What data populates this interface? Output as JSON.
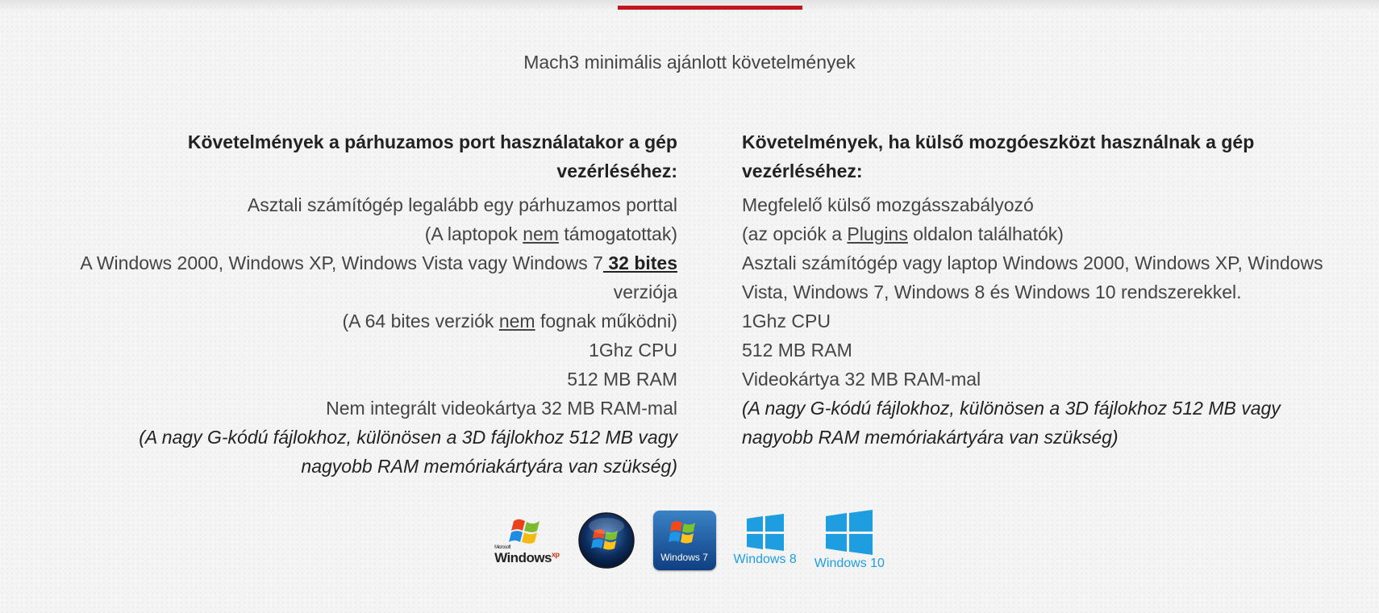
{
  "header": {
    "accent_color": "#c3161c",
    "subtitle": "Mach3 minimális ajánlott követelmények"
  },
  "left": {
    "heading": "Követelmények a párhuzamos port használatakor a gép vezérléséhez:",
    "l1": "Asztali számítógép legalább egy párhuzamos porttal",
    "l2_a": "(A laptopok ",
    "l2_u": "nem",
    "l2_b": " támogatottak)",
    "l3_a": "A Windows 2000, Windows XP, Windows Vista vagy Windows 7",
    "l3_bold": " 32 bites",
    "l4": "verziója",
    "l5_a": "(A 64 bites verziók ",
    "l5_u": "nem",
    "l5_b": " fognak működni)",
    "l6": "1Ghz CPU",
    "l7": "512 MB RAM",
    "l8": "Nem integrált videokártya 32 MB RAM-mal",
    "l9": "(A nagy G-kódú fájlokhoz, különösen a 3D fájlokhoz 512 MB vagy",
    "l10": "nagyobb RAM memóriakártyára van szükség)"
  },
  "right": {
    "heading_1": "Követelmények, ha külső mozgóeszközt használnak a gép",
    "heading_2": "vezérléséhez:",
    "l1": "Megfelelő külső mozgásszabályozó",
    "l2_a": "(az opciók a ",
    "l2_link": "Plugins",
    "l2_b": " oldalon találhatók)",
    "l3": "Asztali számítógép vagy laptop Windows 2000, Windows XP, Windows",
    "l4": "Vista, Windows 7, Windows 8 és Windows 10 rendszerekkel.",
    "l5": "1Ghz CPU",
    "l6": "512 MB RAM",
    "l7": "Videokártya 32 MB RAM-mal",
    "l8": "(A nagy G-kódú fájlokhoz, különösen a 3D fájlokhoz 512 MB vagy",
    "l9": "nagyobb RAM memóriakártyára van szükség)"
  },
  "logos": {
    "xp_small": "Microsoft",
    "xp_name": "Windows",
    "xp_sup": "xp",
    "w7_name": "Windows 7",
    "w8_name": "Windows 8",
    "w10_name": "Windows 10",
    "icons": [
      "windows-xp-logo-icon",
      "windows-vista-orb-icon",
      "windows-7-logo-icon",
      "windows-8-logo-icon",
      "windows-10-logo-icon"
    ]
  }
}
